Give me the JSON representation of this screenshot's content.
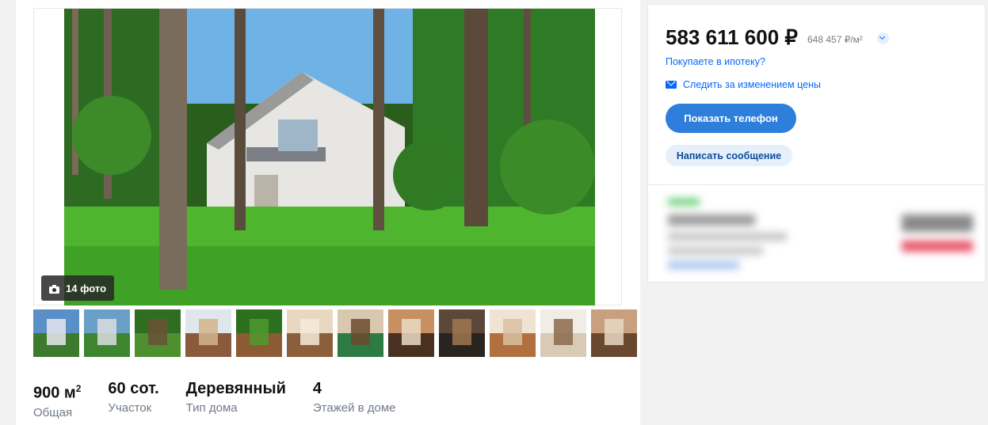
{
  "gallery": {
    "photo_count_label": "14 фото",
    "thumbnails": [
      {
        "name": "thumb-1",
        "colors": [
          "#5a8fc8",
          "#3d7a2e",
          "#e8e8ee"
        ]
      },
      {
        "name": "thumb-2",
        "colors": [
          "#6aa0c8",
          "#3f8530",
          "#dcdce0"
        ]
      },
      {
        "name": "thumb-3",
        "colors": [
          "#2f6e20",
          "#4e8f30",
          "#6b5136"
        ]
      },
      {
        "name": "thumb-4",
        "colors": [
          "#dfe6ec",
          "#8a5a3c",
          "#d2b48c"
        ]
      },
      {
        "name": "thumb-5",
        "colors": [
          "#2c6f1f",
          "#8c5a33",
          "#4f9a30"
        ]
      },
      {
        "name": "thumb-6",
        "colors": [
          "#e8d8c0",
          "#8b5e3c",
          "#f4ead8"
        ]
      },
      {
        "name": "thumb-7",
        "colors": [
          "#d8c8b0",
          "#2d7a45",
          "#6b4a2c"
        ]
      },
      {
        "name": "thumb-8",
        "colors": [
          "#c89060",
          "#4a3020",
          "#eadbc4"
        ]
      },
      {
        "name": "thumb-9",
        "colors": [
          "#5c4838",
          "#2a2420",
          "#a07850"
        ]
      },
      {
        "name": "thumb-10",
        "colors": [
          "#efe4d4",
          "#b07040",
          "#d8c0a0"
        ]
      },
      {
        "name": "thumb-11",
        "colors": [
          "#f0ece6",
          "#d8cab4",
          "#8c6a4c"
        ]
      },
      {
        "name": "thumb-12",
        "colors": [
          "#c8a080",
          "#6a4830",
          "#e8d8c4"
        ]
      }
    ]
  },
  "facts": [
    {
      "value": "900 м",
      "sup": "2",
      "label": "Общая"
    },
    {
      "value": "60 сот.",
      "sup": "",
      "label": "Участок"
    },
    {
      "value": "Деревянный",
      "sup": "",
      "label": "Тип дома"
    },
    {
      "value": "4",
      "sup": "",
      "label": "Этажей в доме"
    }
  ],
  "offer": {
    "price": "583 611 600 ₽",
    "price_per_m2": "648 457 ₽/м²",
    "mortgage_link": "Покупаете в ипотеку?",
    "follow_price": "Следить за изменением цены",
    "show_phone": "Показать телефон",
    "write_message": "Написать сообщение"
  },
  "colors": {
    "accent_blue": "#2e7fdc",
    "link_blue": "#0468ff",
    "soft_blue": "#e6f0fb",
    "thumb_active": "#0aa0b4"
  },
  "icons": [
    "camera-icon",
    "mail-icon",
    "chevron-down-icon"
  ]
}
